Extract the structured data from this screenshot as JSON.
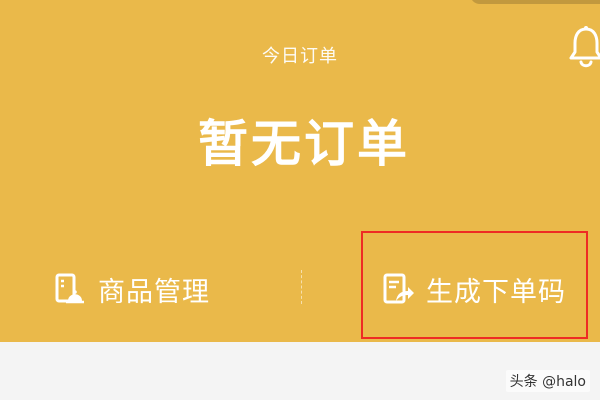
{
  "header": {
    "caption": "今日订单",
    "headline": "暂无订单"
  },
  "actions": {
    "product_management": {
      "label": "商品管理",
      "icon": "product-management-icon"
    },
    "generate_order_code": {
      "label": "生成下单码",
      "icon": "order-code-share-icon"
    }
  },
  "watermark": "头条 @halo",
  "colors": {
    "header_background": "#eab94a",
    "text_on_header": "#ffffff",
    "highlight_border": "#ee2b24",
    "page_background": "#f4f4f4"
  }
}
